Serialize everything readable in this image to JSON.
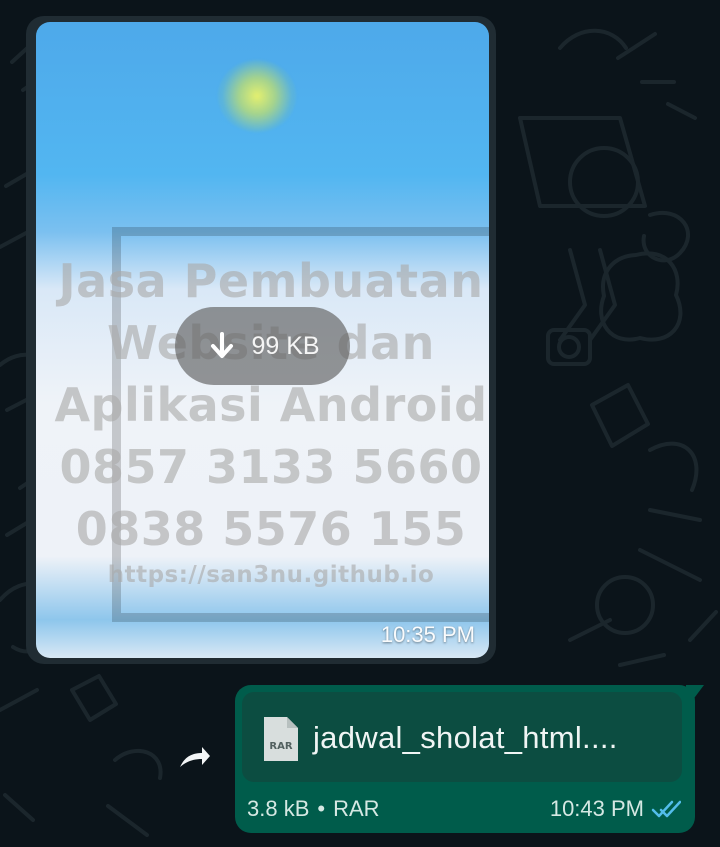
{
  "chat": {
    "incoming_image": {
      "watermark_lines": [
        "Jasa Pembuatan",
        "Website dan",
        "Aplikasi Android",
        "0857 3133 5660",
        "0838 5576 155",
        "https://san3nu.github.io"
      ],
      "download_size": "99 KB",
      "timestamp": "10:35 PM"
    },
    "outgoing_file": {
      "file_type_badge": "RAR",
      "file_name": "jadwal_sholat_html....",
      "file_size": "3.8 kB",
      "meta_separator": "•",
      "file_type": "RAR",
      "timestamp": "10:43 PM"
    }
  },
  "icons": {
    "download": "download-icon",
    "forward": "forward-icon",
    "file": "rar-file-icon",
    "read_receipt": "double-check-icon"
  },
  "colors": {
    "chat_background": "#0b141a",
    "incoming_bubble": "#202c33",
    "outgoing_bubble": "#005c4b",
    "file_card": "#0c4d41",
    "read_receipt": "#53bdeb"
  }
}
